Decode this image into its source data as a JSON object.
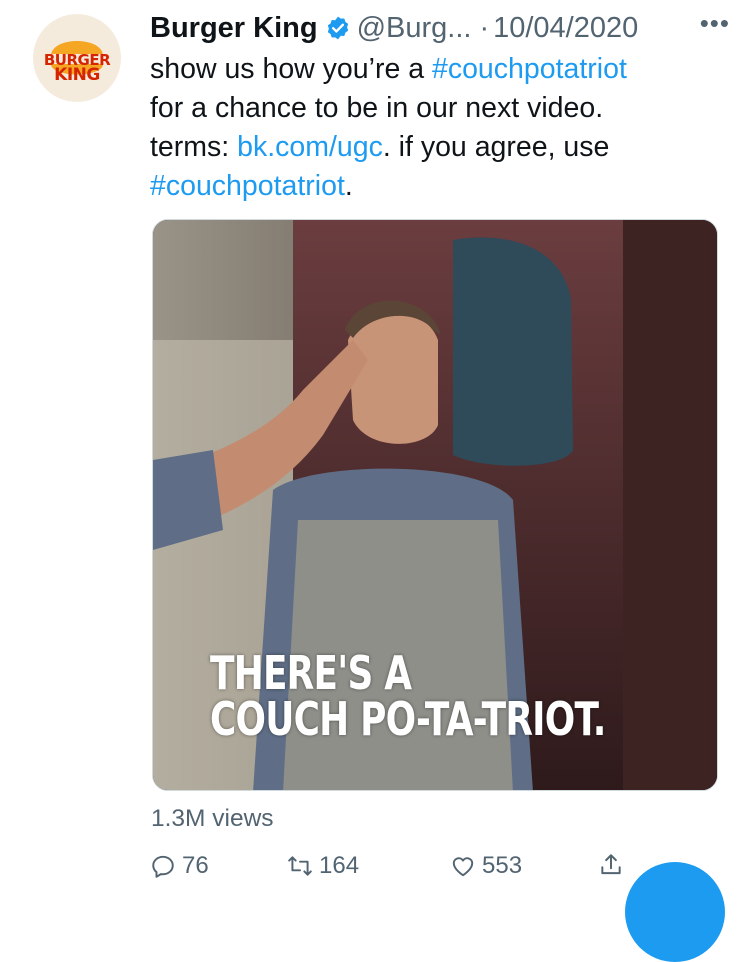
{
  "tweet": {
    "author": {
      "name": "Burger King",
      "handle": "@Burg...",
      "verified": true,
      "avatar_icon": "burger-king-logo",
      "avatar_text_top": "BURGER",
      "avatar_text_bottom": "KING"
    },
    "separator": "·",
    "date": "10/04/2020",
    "more_label": "•••",
    "text": {
      "l1_plain": "show us how you’re a ",
      "l1_link": "#couchpotatriot",
      "l2": "for a chance to be in our next video.",
      "l3_plain": "terms: ",
      "l3_link": "bk.com/ugc",
      "l3_rest": ". if you agree, use",
      "l4_link": "#couchpotatriot",
      "l4_rest": "."
    },
    "media": {
      "caption_line1": "THERE'S A",
      "caption_line2": "COUCH PO-TA-TRIOT."
    },
    "views": "1.3M views",
    "actions": {
      "replies": "76",
      "retweets": "164",
      "likes": "553"
    }
  },
  "colors": {
    "link": "#1d9bf0",
    "muted": "#536471",
    "brand": "#d62300"
  }
}
